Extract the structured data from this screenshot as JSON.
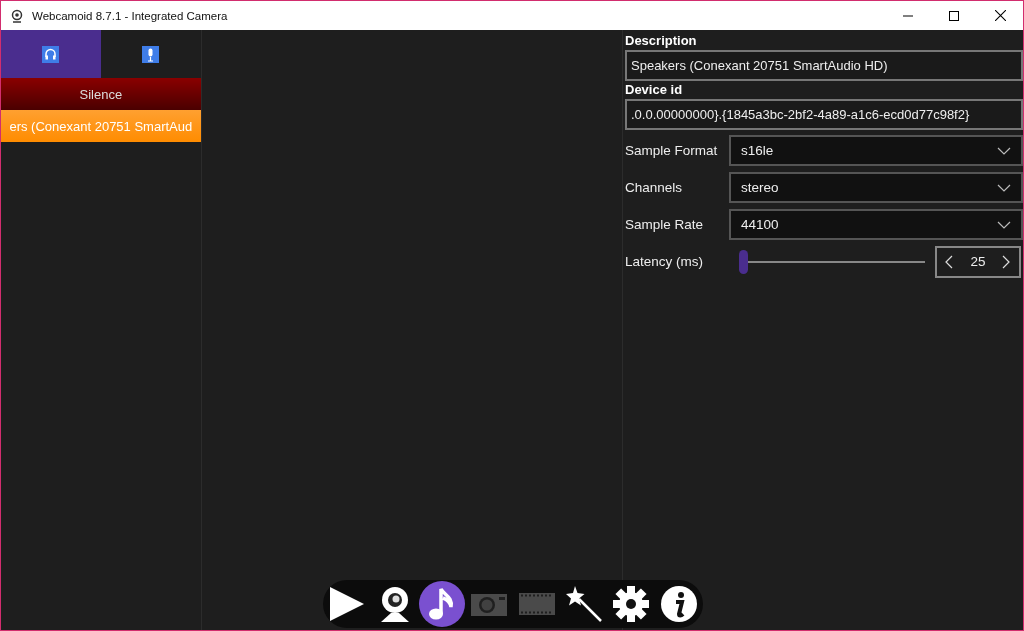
{
  "window": {
    "title": "Webcamoid 8.7.1 - Integrated Camera"
  },
  "tabs": [
    {
      "kind": "headphones",
      "selected": true
    },
    {
      "kind": "microphone",
      "selected": false
    }
  ],
  "devices": [
    {
      "label": "Silence",
      "selected": false
    },
    {
      "label": "ers (Conexant 20751 SmartAud",
      "selected": true
    }
  ],
  "description": {
    "label": "Description",
    "value": "Speakers (Conexant 20751 SmartAudio HD)"
  },
  "device_id": {
    "label": "Device id",
    "value": ".0.0.00000000}.{1845a3bc-2bf2-4a89-a1c6-ecd0d77c98f2}"
  },
  "selects": [
    {
      "label": "Sample Format",
      "value": "s16le"
    },
    {
      "label": "Channels",
      "value": "stereo"
    },
    {
      "label": "Sample Rate",
      "value": "44100"
    }
  ],
  "latency": {
    "label": "Latency (ms)",
    "level": 0,
    "value": "25"
  },
  "toolbar": [
    {
      "kind": "play",
      "selected": false,
      "disabled": false
    },
    {
      "kind": "webcam",
      "selected": false,
      "disabled": false
    },
    {
      "kind": "music",
      "selected": true,
      "disabled": false
    },
    {
      "kind": "camera",
      "selected": false,
      "disabled": true
    },
    {
      "kind": "film",
      "selected": false,
      "disabled": true
    },
    {
      "kind": "wand",
      "selected": false,
      "disabled": false
    },
    {
      "kind": "gear",
      "selected": false,
      "disabled": false
    },
    {
      "kind": "info",
      "selected": false,
      "disabled": false
    }
  ]
}
